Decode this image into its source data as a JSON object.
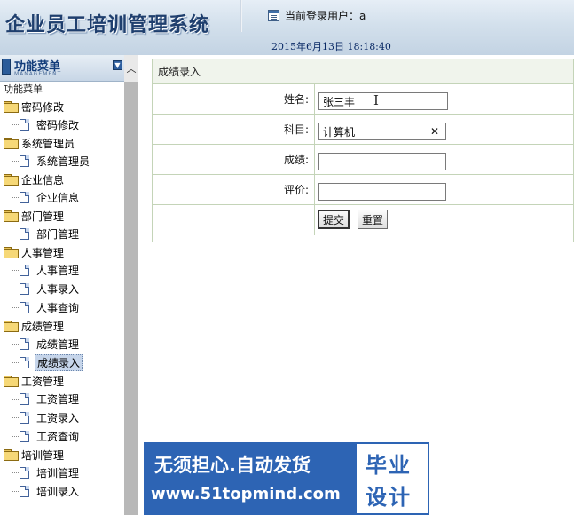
{
  "header": {
    "app_title": "企业员工培训管理系统",
    "user_label": "当前登录用户：a",
    "datetime": "2015年6月13日  18:18:40"
  },
  "sidebar": {
    "title": "功能菜单",
    "subtitle": "MANAGEMENT",
    "root_label": "功能菜单",
    "groups": [
      {
        "label": "密码修改",
        "items": [
          "密码修改"
        ]
      },
      {
        "label": "系统管理员",
        "items": [
          "系统管理员"
        ]
      },
      {
        "label": "企业信息",
        "items": [
          "企业信息"
        ]
      },
      {
        "label": "部门管理",
        "items": [
          "部门管理"
        ]
      },
      {
        "label": "人事管理",
        "items": [
          "人事管理",
          "人事录入",
          "人事查询"
        ]
      },
      {
        "label": "成绩管理",
        "items": [
          "成绩管理",
          "成绩录入"
        ]
      },
      {
        "label": "工资管理",
        "items": [
          "工资管理",
          "工资录入",
          "工资查询"
        ]
      },
      {
        "label": "培训管理",
        "items": [
          "培训管理",
          "培训录入"
        ]
      }
    ],
    "selected_item": "成绩录入"
  },
  "form": {
    "title": "成绩录入",
    "fields": {
      "name": {
        "label": "姓名:",
        "value": "张三丰"
      },
      "subject": {
        "label": "科目:",
        "value": "计算机"
      },
      "score": {
        "label": "成绩:",
        "value": ""
      },
      "comment": {
        "label": "评价:",
        "value": ""
      }
    },
    "submit_label": "提交",
    "reset_label": "重置"
  },
  "watermark": {
    "line1": "无须担心.自动发货",
    "line2": "www.51topmind.com",
    "brand_line1": "毕业",
    "brand_line2": "设计"
  },
  "colors": {
    "header_text": "#1f3f6e",
    "form_border": "#c4d4b8",
    "selected_bg": "#c6d5ea",
    "watermark_blue": "#2d64b4"
  },
  "icons": [
    "user-icon",
    "menu-logo-icon",
    "collapse-icon",
    "folder-icon",
    "document-icon",
    "clear-icon",
    "text-cursor-icon",
    "scroll-up-icon"
  ]
}
